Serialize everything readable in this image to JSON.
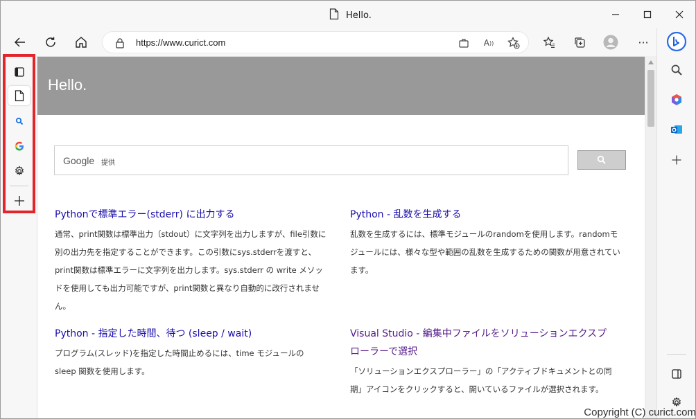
{
  "window": {
    "tab_title": "Hello.",
    "controls": {
      "minimize": "minimize",
      "maximize": "maximize",
      "close": "close"
    }
  },
  "toolbar": {
    "url": "https://www.curict.com"
  },
  "vertical_tabs": {
    "items": [
      {
        "icon": "tab-actions-icon"
      },
      {
        "icon": "page-icon",
        "active": true
      },
      {
        "icon": "search-icon"
      },
      {
        "icon": "google-icon"
      },
      {
        "icon": "gear-icon"
      }
    ],
    "new_tab_icon": "plus-icon"
  },
  "page": {
    "hero_title": "Hello.",
    "search": {
      "logo": "Google",
      "sub": "提供"
    },
    "articles": [
      {
        "title": "Pythonで標準エラー(stderr) に出力する",
        "body_lines": [
          "通常、print関数は標準出力（stdout）に文字列を出力しますが、file引数に",
          "別の出力先を指定することができます。この引数にsys.stderrを渡すと、",
          "print関数は標準エラーに文字列を出力します。sys.stderr の write メソッ",
          "ドを使用しても出力可能ですが、print関数と異なり自動的に改行されませ",
          "ん。"
        ]
      },
      {
        "title": "Python - 乱数を生成する",
        "body_lines": [
          "乱数を生成するには、標準モジュールのrandomを使用します。randomモ",
          "ジュールには、様々な型や範囲の乱数を生成するための関数が用意されてい",
          "ます。"
        ]
      },
      {
        "title": "Python - 指定した時間、待つ (sleep / wait)",
        "body_lines": [
          "プログラム(スレッド)を指定した時間止めるには、time モジュールの",
          "sleep 関数を使用します。"
        ]
      },
      {
        "title_lines": [
          "Visual Studio - 編集中ファイルをソリューションエクスプ",
          "ローラーで選択"
        ],
        "body_lines": [
          "「ソリューションエクスプローラー」の「アクティブドキュメントとの同",
          "期」アイコンをクリックすると、開いているファイルが選択されます。"
        ]
      }
    ],
    "footer": "Copyright (C) curict.com"
  },
  "colors": {
    "hero_bg": "#999999",
    "link": "#1a0dab",
    "visited_link": "#551a8b",
    "highlight_border": "#e3242b"
  }
}
